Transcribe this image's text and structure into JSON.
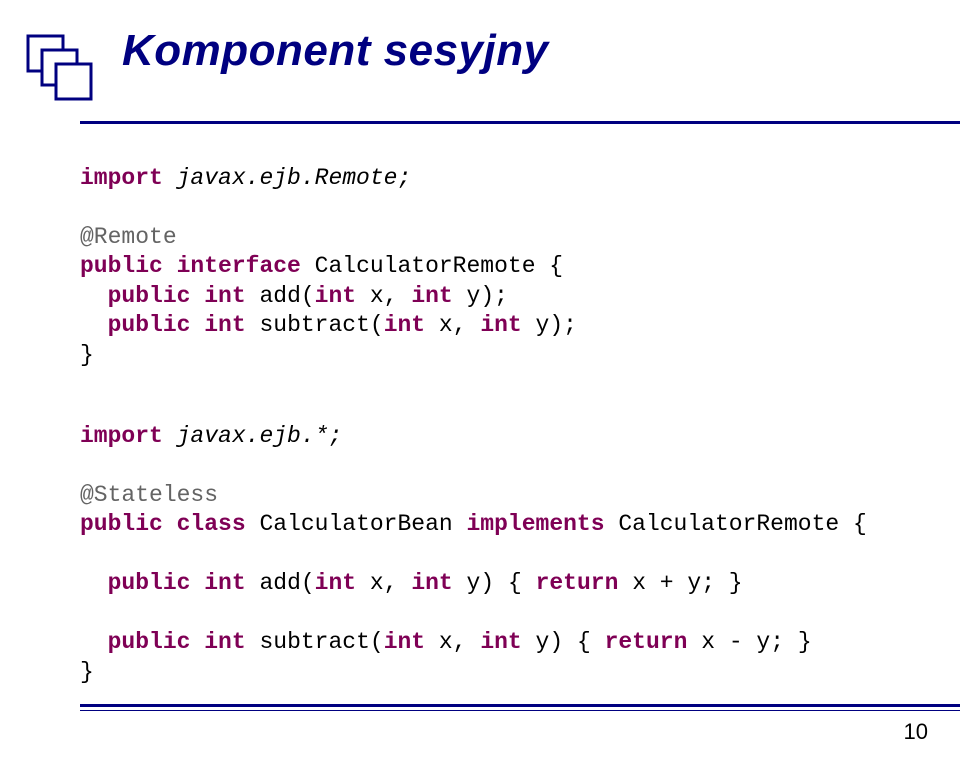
{
  "title": "Komponent sesyjny",
  "page_number": "10",
  "code1": {
    "line1_import": "import",
    "line1_rest": " javax.ejb.Remote;",
    "line3_ann": "@Remote",
    "line4_public": "public",
    "line4_interface": " interface",
    "line4_rest": " CalculatorRemote {",
    "line5_indent": "  ",
    "line5_public": "public",
    "line5_int": " int",
    "line5_mid": " add(",
    "line5_int2": "int",
    "line5_mid2": " x, ",
    "line5_int3": "int",
    "line5_end": " y);",
    "line6_indent": "  ",
    "line6_public": "public",
    "line6_int": " int",
    "line6_mid": " subtract(",
    "line6_int2": "int",
    "line6_mid2": " x, ",
    "line6_int3": "int",
    "line6_end": " y);",
    "line7": "}"
  },
  "code2": {
    "line1_import": "import",
    "line1_rest": " javax.ejb.*;",
    "line3_ann": "@Stateless",
    "line4_public": "public",
    "line4_class": " class",
    "line4_mid": " CalculatorBean ",
    "line4_implements": "implements",
    "line4_rest": " CalculatorRemote {",
    "line6_indent": "  ",
    "line6_public": "public",
    "line6_int": " int",
    "line6_mid": " add(",
    "line6_int2": "int",
    "line6_mid2": " x, ",
    "line6_int3": "int",
    "line6_mid3": " y) { ",
    "line6_return": "return",
    "line6_end": " x + y; }",
    "line8_indent": "  ",
    "line8_public": "public",
    "line8_int": " int",
    "line8_mid": " subtract(",
    "line8_int2": "int",
    "line8_mid2": " x, ",
    "line8_int3": "int",
    "line8_mid3": " y) { ",
    "line8_return": "return",
    "line8_end": " x - y; }",
    "line9": "}"
  }
}
